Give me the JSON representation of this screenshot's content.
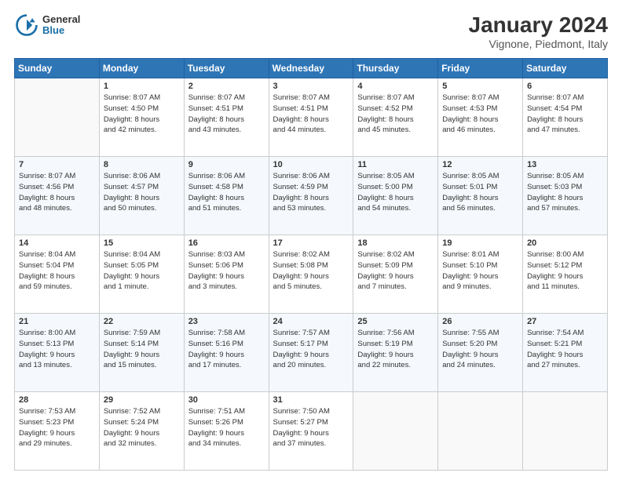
{
  "logo": {
    "general": "General",
    "blue": "Blue"
  },
  "header": {
    "title": "January 2024",
    "subtitle": "Vignone, Piedmont, Italy"
  },
  "weekdays": [
    "Sunday",
    "Monday",
    "Tuesday",
    "Wednesday",
    "Thursday",
    "Friday",
    "Saturday"
  ],
  "weeks": [
    [
      {
        "day": "",
        "info": ""
      },
      {
        "day": "1",
        "info": "Sunrise: 8:07 AM\nSunset: 4:50 PM\nDaylight: 8 hours\nand 42 minutes."
      },
      {
        "day": "2",
        "info": "Sunrise: 8:07 AM\nSunset: 4:51 PM\nDaylight: 8 hours\nand 43 minutes."
      },
      {
        "day": "3",
        "info": "Sunrise: 8:07 AM\nSunset: 4:51 PM\nDaylight: 8 hours\nand 44 minutes."
      },
      {
        "day": "4",
        "info": "Sunrise: 8:07 AM\nSunset: 4:52 PM\nDaylight: 8 hours\nand 45 minutes."
      },
      {
        "day": "5",
        "info": "Sunrise: 8:07 AM\nSunset: 4:53 PM\nDaylight: 8 hours\nand 46 minutes."
      },
      {
        "day": "6",
        "info": "Sunrise: 8:07 AM\nSunset: 4:54 PM\nDaylight: 8 hours\nand 47 minutes."
      }
    ],
    [
      {
        "day": "7",
        "info": "Sunrise: 8:07 AM\nSunset: 4:56 PM\nDaylight: 8 hours\nand 48 minutes."
      },
      {
        "day": "8",
        "info": "Sunrise: 8:06 AM\nSunset: 4:57 PM\nDaylight: 8 hours\nand 50 minutes."
      },
      {
        "day": "9",
        "info": "Sunrise: 8:06 AM\nSunset: 4:58 PM\nDaylight: 8 hours\nand 51 minutes."
      },
      {
        "day": "10",
        "info": "Sunrise: 8:06 AM\nSunset: 4:59 PM\nDaylight: 8 hours\nand 53 minutes."
      },
      {
        "day": "11",
        "info": "Sunrise: 8:05 AM\nSunset: 5:00 PM\nDaylight: 8 hours\nand 54 minutes."
      },
      {
        "day": "12",
        "info": "Sunrise: 8:05 AM\nSunset: 5:01 PM\nDaylight: 8 hours\nand 56 minutes."
      },
      {
        "day": "13",
        "info": "Sunrise: 8:05 AM\nSunset: 5:03 PM\nDaylight: 8 hours\nand 57 minutes."
      }
    ],
    [
      {
        "day": "14",
        "info": "Sunrise: 8:04 AM\nSunset: 5:04 PM\nDaylight: 8 hours\nand 59 minutes."
      },
      {
        "day": "15",
        "info": "Sunrise: 8:04 AM\nSunset: 5:05 PM\nDaylight: 9 hours\nand 1 minute."
      },
      {
        "day": "16",
        "info": "Sunrise: 8:03 AM\nSunset: 5:06 PM\nDaylight: 9 hours\nand 3 minutes."
      },
      {
        "day": "17",
        "info": "Sunrise: 8:02 AM\nSunset: 5:08 PM\nDaylight: 9 hours\nand 5 minutes."
      },
      {
        "day": "18",
        "info": "Sunrise: 8:02 AM\nSunset: 5:09 PM\nDaylight: 9 hours\nand 7 minutes."
      },
      {
        "day": "19",
        "info": "Sunrise: 8:01 AM\nSunset: 5:10 PM\nDaylight: 9 hours\nand 9 minutes."
      },
      {
        "day": "20",
        "info": "Sunrise: 8:00 AM\nSunset: 5:12 PM\nDaylight: 9 hours\nand 11 minutes."
      }
    ],
    [
      {
        "day": "21",
        "info": "Sunrise: 8:00 AM\nSunset: 5:13 PM\nDaylight: 9 hours\nand 13 minutes."
      },
      {
        "day": "22",
        "info": "Sunrise: 7:59 AM\nSunset: 5:14 PM\nDaylight: 9 hours\nand 15 minutes."
      },
      {
        "day": "23",
        "info": "Sunrise: 7:58 AM\nSunset: 5:16 PM\nDaylight: 9 hours\nand 17 minutes."
      },
      {
        "day": "24",
        "info": "Sunrise: 7:57 AM\nSunset: 5:17 PM\nDaylight: 9 hours\nand 20 minutes."
      },
      {
        "day": "25",
        "info": "Sunrise: 7:56 AM\nSunset: 5:19 PM\nDaylight: 9 hours\nand 22 minutes."
      },
      {
        "day": "26",
        "info": "Sunrise: 7:55 AM\nSunset: 5:20 PM\nDaylight: 9 hours\nand 24 minutes."
      },
      {
        "day": "27",
        "info": "Sunrise: 7:54 AM\nSunset: 5:21 PM\nDaylight: 9 hours\nand 27 minutes."
      }
    ],
    [
      {
        "day": "28",
        "info": "Sunrise: 7:53 AM\nSunset: 5:23 PM\nDaylight: 9 hours\nand 29 minutes."
      },
      {
        "day": "29",
        "info": "Sunrise: 7:52 AM\nSunset: 5:24 PM\nDaylight: 9 hours\nand 32 minutes."
      },
      {
        "day": "30",
        "info": "Sunrise: 7:51 AM\nSunset: 5:26 PM\nDaylight: 9 hours\nand 34 minutes."
      },
      {
        "day": "31",
        "info": "Sunrise: 7:50 AM\nSunset: 5:27 PM\nDaylight: 9 hours\nand 37 minutes."
      },
      {
        "day": "",
        "info": ""
      },
      {
        "day": "",
        "info": ""
      },
      {
        "day": "",
        "info": ""
      }
    ]
  ]
}
